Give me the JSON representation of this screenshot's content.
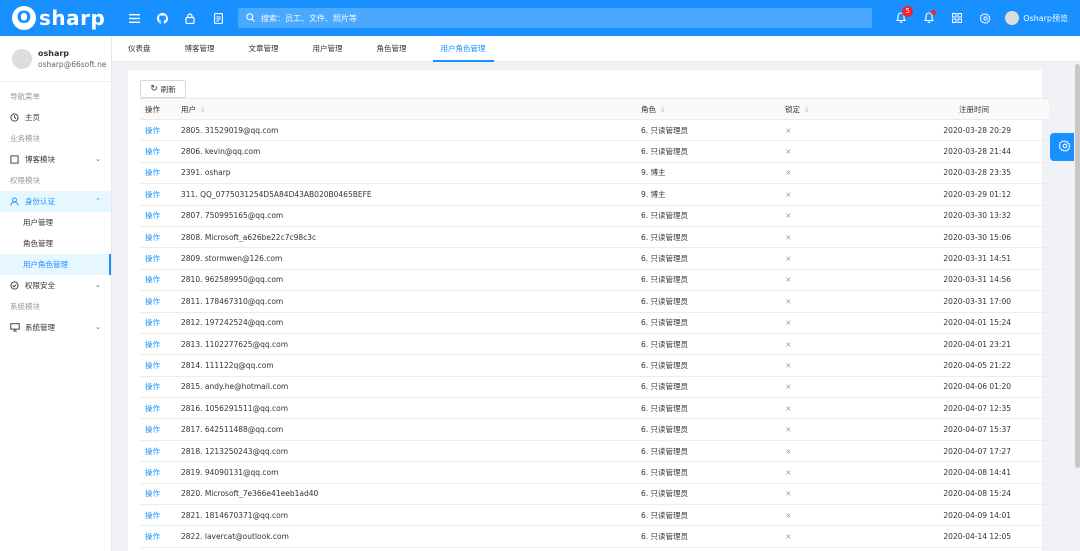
{
  "header": {
    "logo_letter": "O",
    "logo_text": "sharp",
    "search_placeholder": "搜索：员工、文件、照片等",
    "notification_count": "5",
    "user_name": "Osharp预览"
  },
  "sidebar": {
    "user": {
      "name": "osharp",
      "email": "osharp@66soft.ne"
    },
    "groups": {
      "nav": "导航菜单",
      "business": "业务模块",
      "permission": "权限模块",
      "system": "系统模块"
    },
    "items": {
      "home": "主页",
      "blog": "博客模块",
      "identity": "身份认证",
      "user_mgmt": "用户管理",
      "role_mgmt": "角色管理",
      "user_role_mgmt": "用户角色管理",
      "security": "权限安全",
      "system_mgmt": "系统管理"
    }
  },
  "tabs": [
    "仪表盘",
    "博客管理",
    "文章管理",
    "用户管理",
    "角色管理",
    "用户角色管理"
  ],
  "toolbar": {
    "refresh_label": "刷新"
  },
  "table": {
    "columns": {
      "action": "操作",
      "user": "用户",
      "role": "角色",
      "locked": "锁定",
      "registered": "注册时间"
    },
    "action_label": "操作",
    "lock_symbol": "×",
    "rows": [
      {
        "user": "2805. 31529019@qq.com",
        "role": "6. 只读管理员",
        "time": "2020-03-28 20:29"
      },
      {
        "user": "2806. kevin@qq.com",
        "role": "6. 只读管理员",
        "time": "2020-03-28 21:44"
      },
      {
        "user": "2391. osharp",
        "role": "9. 博主",
        "time": "2020-03-28 23:35"
      },
      {
        "user": "311. QQ_0775031254D5A84D43AB020B0465BEFE",
        "role": "9. 博主",
        "time": "2020-03-29 01:12"
      },
      {
        "user": "2807. 750995165@qq.com",
        "role": "6. 只读管理员",
        "time": "2020-03-30 13:32"
      },
      {
        "user": "2808. Microsoft_a626be22c7c98c3c",
        "role": "6. 只读管理员",
        "time": "2020-03-30 15:06"
      },
      {
        "user": "2809. stormwen@126.com",
        "role": "6. 只读管理员",
        "time": "2020-03-31 14:51"
      },
      {
        "user": "2810. 962589950@qq.com",
        "role": "6. 只读管理员",
        "time": "2020-03-31 14:56"
      },
      {
        "user": "2811. 178467310@qq.com",
        "role": "6. 只读管理员",
        "time": "2020-03-31 17:00"
      },
      {
        "user": "2812. 197242524@qq.com",
        "role": "6. 只读管理员",
        "time": "2020-04-01 15:24"
      },
      {
        "user": "2813. 1102277625@qq.com",
        "role": "6. 只读管理员",
        "time": "2020-04-01 23:21"
      },
      {
        "user": "2814. 111122q@qq.com",
        "role": "6. 只读管理员",
        "time": "2020-04-05 21:22"
      },
      {
        "user": "2815. andy.he@hotmail.com",
        "role": "6. 只读管理员",
        "time": "2020-04-06 01:20"
      },
      {
        "user": "2816. 1056291511@qq.com",
        "role": "6. 只读管理员",
        "time": "2020-04-07 12:35"
      },
      {
        "user": "2817. 642511488@qq.com",
        "role": "6. 只读管理员",
        "time": "2020-04-07 15:37"
      },
      {
        "user": "2818. 1213250243@qq.com",
        "role": "6. 只读管理员",
        "time": "2020-04-07 17:27"
      },
      {
        "user": "2819. 94090131@qq.com",
        "role": "6. 只读管理员",
        "time": "2020-04-08 14:41"
      },
      {
        "user": "2820. Microsoft_7e366e41eeb1ad40",
        "role": "6. 只读管理员",
        "time": "2020-04-08 15:24"
      },
      {
        "user": "2821. 1814670371@qq.com",
        "role": "6. 只读管理员",
        "time": "2020-04-09 14:01"
      },
      {
        "user": "2822. lavercat@outlook.com",
        "role": "6. 只读管理员",
        "time": "2020-04-14 12:05"
      }
    ]
  },
  "colors": {
    "primary": "#1890ff",
    "badge": "#f5222d"
  }
}
